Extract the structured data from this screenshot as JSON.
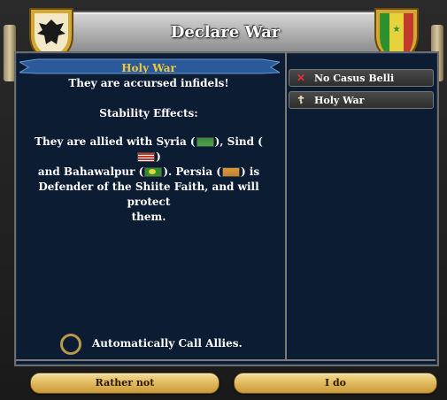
{
  "window": {
    "title": "Declare War"
  },
  "casus_belli": {
    "selected_title": "Holy War",
    "description": "They are accursed infidels!",
    "stability_label": "Stability Effects:",
    "allies_text": {
      "part1": "They are allied with Syria (",
      "part2": "), Sind (",
      "part3": ")",
      "part4": "and Bahawalpur (",
      "part5": "). Persia (",
      "part6": ") is",
      "part7": "Defender of the Shiite Faith, and will protect",
      "part8": "them."
    }
  },
  "cb_list": [
    {
      "label": "No Casus Belli",
      "icon": "x-icon"
    },
    {
      "label": "Holy War",
      "icon": "cross-icon"
    }
  ],
  "options": {
    "auto_call_allies": "Automatically Call Allies.",
    "auto_call_checked": false
  },
  "buttons": {
    "cancel": "Rather not",
    "confirm": "I do"
  },
  "colors": {
    "panel": "#0c1c33",
    "title_gold": "#f0c83a",
    "button_gold": "#e0b95c"
  }
}
